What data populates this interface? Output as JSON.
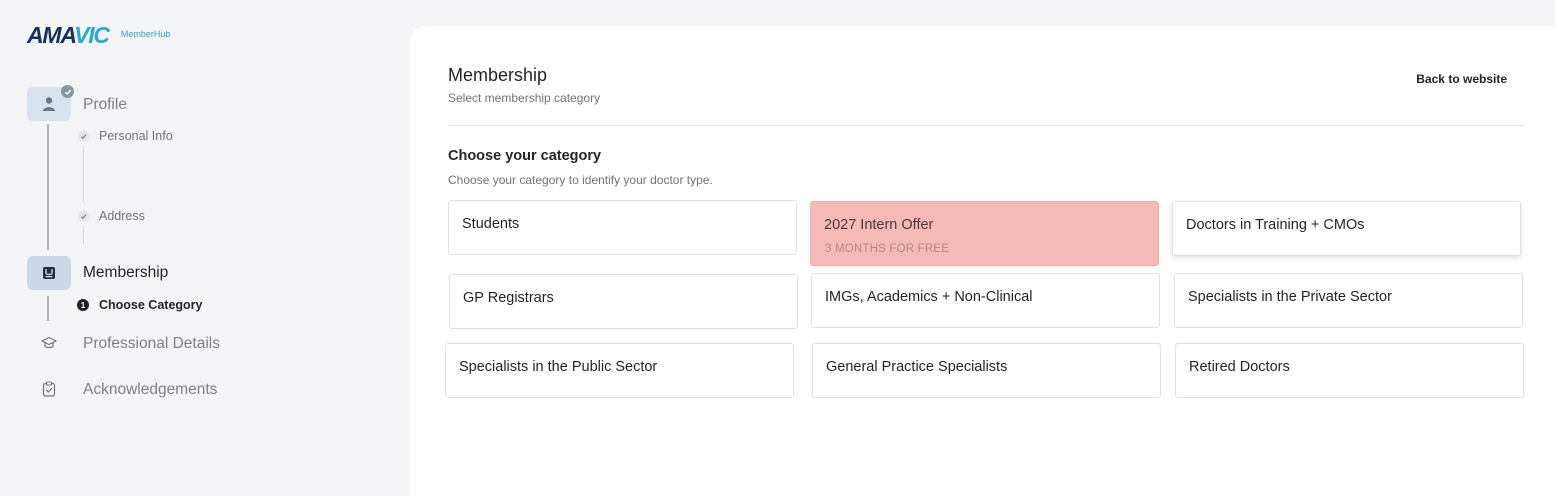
{
  "brand": {
    "logo_main": "AMA",
    "logo_accent": "VIC",
    "subtitle": "MemberHub"
  },
  "sidebar": {
    "steps": [
      {
        "label": "Profile",
        "icon": "user-icon",
        "state": "done",
        "substeps": [
          {
            "label": "Personal Info",
            "state": "done"
          },
          {
            "label": "Address",
            "state": "done"
          }
        ]
      },
      {
        "label": "Membership",
        "icon": "membership-card-icon",
        "state": "active",
        "substeps": [
          {
            "label": "Choose Category",
            "state": "active",
            "number": "1"
          }
        ]
      },
      {
        "label": "Professional Details",
        "icon": "graduation-cap-icon",
        "state": "pending",
        "substeps": []
      },
      {
        "label": "Acknowledgements",
        "icon": "clipboard-check-icon",
        "state": "pending",
        "substeps": []
      }
    ]
  },
  "main": {
    "title": "Membership",
    "subtitle": "Select membership category",
    "back_link": "Back to website",
    "section_title": "Choose your category",
    "section_subtitle": "Choose your category to identify your doctor type.",
    "categories": [
      {
        "label": "Students"
      },
      {
        "label": "2027 Intern Offer",
        "sub": "3 MONTHS FOR FREE",
        "highlight": true
      },
      {
        "label": "Doctors in Training + CMOs"
      },
      {
        "label": "GP Registrars"
      },
      {
        "label": "IMGs, Academics + Non-Clinical"
      },
      {
        "label": "Specialists in the Private Sector"
      },
      {
        "label": "Specialists in the Public Sector"
      },
      {
        "label": "General Practice Specialists"
      },
      {
        "label": "Retired Doctors"
      }
    ]
  },
  "colors": {
    "brand_navy": "#16335c",
    "brand_accent": "#2ba6d6",
    "offer_bg": "#f5b9b6",
    "step_bg": "#d7e3ee"
  }
}
